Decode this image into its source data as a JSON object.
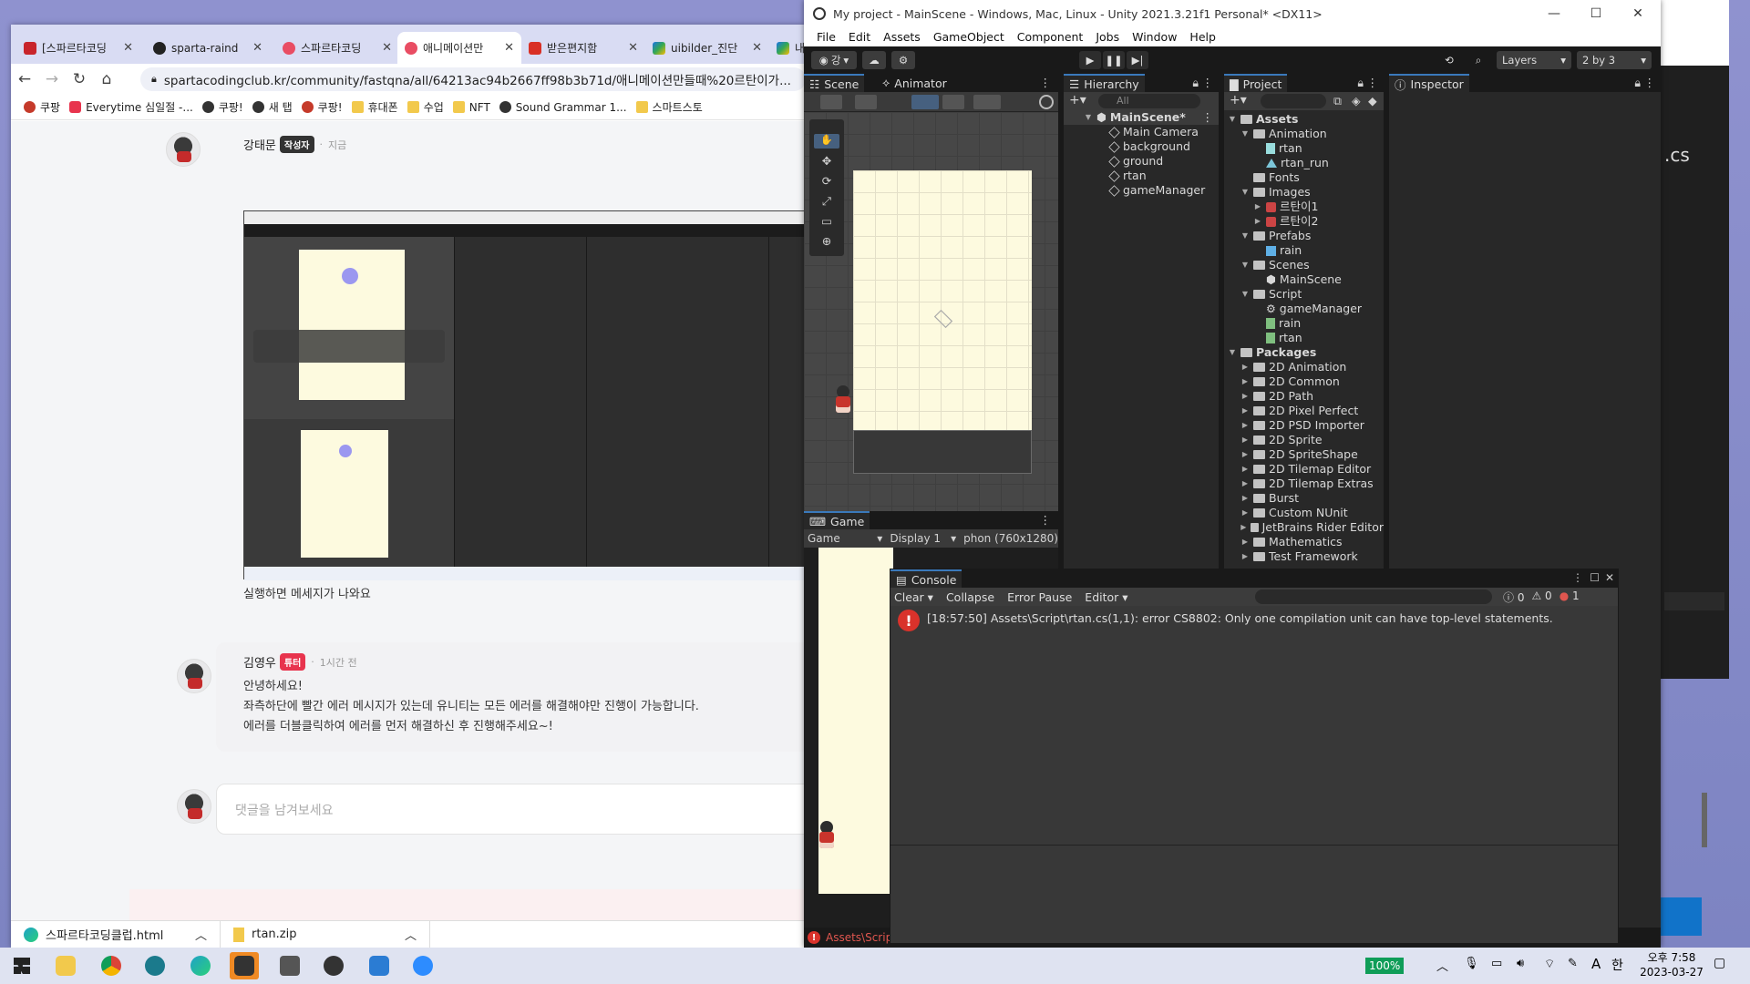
{
  "browser": {
    "tabs": [
      {
        "label": "[스파르타코딩",
        "color": "#c8242b"
      },
      {
        "label": "sparta-raind",
        "color": "#222222"
      },
      {
        "label": "스파르타코딩",
        "color": "#e94d63"
      },
      {
        "label": "애니메이션만",
        "color": "#e94d63"
      },
      {
        "label": "받은편지함",
        "color": "#d93025"
      },
      {
        "label": "uibilder_진단",
        "color": "#1a73e8"
      },
      {
        "label": "내",
        "color": "#1a73e8"
      }
    ],
    "url": "spartacodingclub.kr/community/fastqna/all/64213ac94b2667ff98b3b71d/애니메이션만들때%20르탄이가...",
    "bookmarks": [
      "쿠팡",
      "Everytime 심일절 -...",
      "쿠팡!",
      "새 탭",
      "쿠팡!",
      "휴대폰",
      "수업",
      "NFT",
      "Sound Grammar 1...",
      "스마트스토"
    ],
    "comments": [
      {
        "author": "강태문",
        "badge": "작성자",
        "badge_color": "#333333",
        "time": "지금",
        "text": "실행하면 메세지가 나와요"
      },
      {
        "author": "김영우",
        "badge": "튜터",
        "badge_color": "#e8344e",
        "time": "1시간 전",
        "lines": [
          "안녕하세요!",
          "좌측하단에 빨간 에러 메시지가 있는데 유니티는 모든 에러를 해결해야만 진행이 가능합니다.",
          "에러를 더블클릭하여 에러를 먼저 해결하신 후 진행해주세요~!"
        ]
      }
    ],
    "comment_placeholder": "댓글을 남겨보세요",
    "downloads": [
      "스파르타코딩클럽.html",
      "rtan.zip"
    ]
  },
  "unity": {
    "title": "My project - MainScene - Windows, Mac, Linux - Unity 2021.3.21f1 Personal* <DX11>",
    "menu": [
      "File",
      "Edit",
      "Assets",
      "GameObject",
      "Component",
      "Jobs",
      "Window",
      "Help"
    ],
    "account_label": "강",
    "layers_label": "Layers",
    "layout_label": "2 by 3",
    "scene_tabs": [
      "Scene",
      "Animator"
    ],
    "hierarchy_tab": "Hierarchy",
    "hierarchy_search": "All",
    "hierarchy": {
      "scene": "MainScene*",
      "objects": [
        "Main Camera",
        "background",
        "ground",
        "rtan",
        "gameManager"
      ]
    },
    "project_tab": "Project",
    "inspector_tab": "Inspector",
    "project_tree": [
      {
        "label": "Assets",
        "depth": 0,
        "bold": true,
        "kind": "folder-open"
      },
      {
        "label": "Animation",
        "depth": 1,
        "kind": "folder-open"
      },
      {
        "label": "rtan",
        "depth": 2,
        "kind": "anim"
      },
      {
        "label": "rtan_run",
        "depth": 2,
        "kind": "clip"
      },
      {
        "label": "Fonts",
        "depth": 1,
        "kind": "folder"
      },
      {
        "label": "Images",
        "depth": 1,
        "kind": "folder-open"
      },
      {
        "label": "르탄이1",
        "depth": 2,
        "kind": "sprite",
        "expandable": true
      },
      {
        "label": "르탄이2",
        "depth": 2,
        "kind": "sprite",
        "expandable": true
      },
      {
        "label": "Prefabs",
        "depth": 1,
        "kind": "folder-open"
      },
      {
        "label": "rain",
        "depth": 2,
        "kind": "prefab"
      },
      {
        "label": "Scenes",
        "depth": 1,
        "kind": "folder-open"
      },
      {
        "label": "MainScene",
        "depth": 2,
        "kind": "unity"
      },
      {
        "label": "Script",
        "depth": 1,
        "kind": "folder-open"
      },
      {
        "label": "gameManager",
        "depth": 2,
        "kind": "gear"
      },
      {
        "label": "rain",
        "depth": 2,
        "kind": "script"
      },
      {
        "label": "rtan",
        "depth": 2,
        "kind": "script"
      },
      {
        "label": "Packages",
        "depth": 0,
        "bold": true,
        "kind": "folder-open"
      },
      {
        "label": "2D Animation",
        "depth": 1,
        "kind": "folder",
        "expandable": true
      },
      {
        "label": "2D Common",
        "depth": 1,
        "kind": "folder",
        "expandable": true
      },
      {
        "label": "2D Path",
        "depth": 1,
        "kind": "folder",
        "expandable": true
      },
      {
        "label": "2D Pixel Perfect",
        "depth": 1,
        "kind": "folder",
        "expandable": true
      },
      {
        "label": "2D PSD Importer",
        "depth": 1,
        "kind": "folder",
        "expandable": true
      },
      {
        "label": "2D Sprite",
        "depth": 1,
        "kind": "folder",
        "expandable": true
      },
      {
        "label": "2D SpriteShape",
        "depth": 1,
        "kind": "folder",
        "expandable": true
      },
      {
        "label": "2D Tilemap Editor",
        "depth": 1,
        "kind": "folder",
        "expandable": true
      },
      {
        "label": "2D Tilemap Extras",
        "depth": 1,
        "kind": "folder",
        "expandable": true
      },
      {
        "label": "Burst",
        "depth": 1,
        "kind": "folder",
        "expandable": true
      },
      {
        "label": "Custom NUnit",
        "depth": 1,
        "kind": "folder",
        "expandable": true
      },
      {
        "label": "JetBrains Rider Editor",
        "depth": 1,
        "kind": "folder",
        "expandable": true
      },
      {
        "label": "Mathematics",
        "depth": 1,
        "kind": "folder",
        "expandable": true
      },
      {
        "label": "Test Framework",
        "depth": 1,
        "kind": "folder",
        "expandable": true
      }
    ],
    "game": {
      "tab": "Game",
      "mode": "Game",
      "display": "Display 1",
      "resolution": "phon (760x1280)"
    },
    "console": {
      "tab": "Console",
      "buttons": [
        "Clear",
        "Collapse",
        "Error Pause",
        "Editor"
      ],
      "counts": {
        "log": "0",
        "warn": "0",
        "error": "1"
      },
      "message": "[18:57:50] Assets\\Script\\rtan.cs(1,1): error CS8802: Only one compilation unit can have top-level statements."
    },
    "status_error": "Assets\\Script"
  },
  "background_window": {
    "text": ".cs"
  },
  "taskbar": {
    "battery": "100%",
    "time": "오후 7:58",
    "date": "2023-03-27",
    "ime": "A",
    "ime2": "한"
  },
  "colors": {
    "unity_dark": "#282828",
    "error_red": "#d9322b",
    "accent_blue": "#3a79bb"
  }
}
